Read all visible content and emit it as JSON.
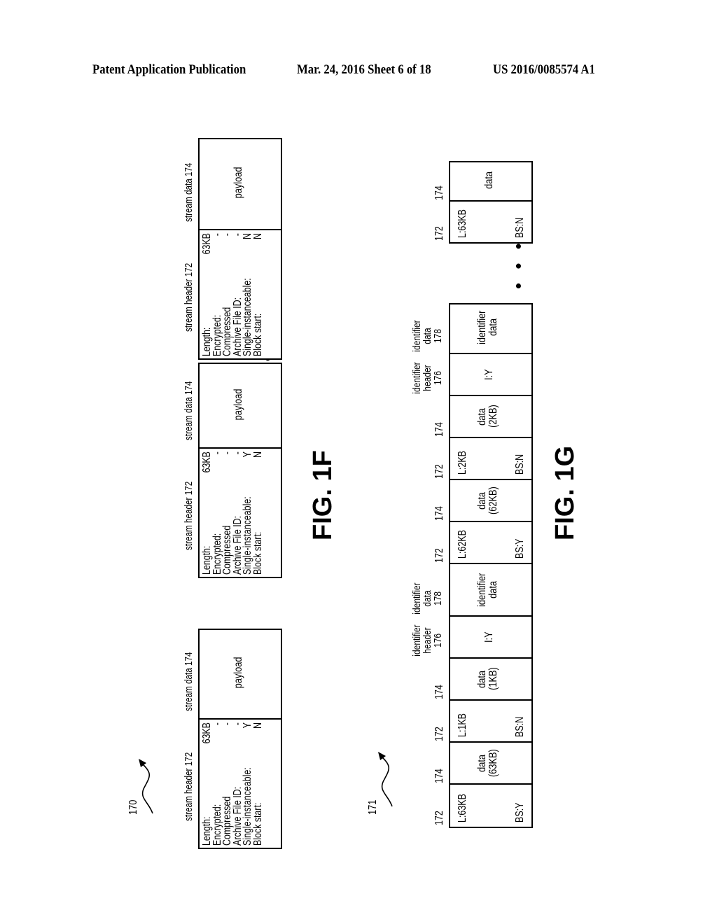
{
  "page_header": {
    "left": "Patent Application Publication",
    "center": "Mar. 24, 2016  Sheet 6 of 18",
    "right": "US 2016/0085574 A1"
  },
  "fig_1f": {
    "ref_number": "170",
    "caption": "FIG. 1F",
    "ellipsis": "• • •",
    "field_names": [
      "Length:",
      "Encrypted:",
      "Compressed",
      "Archive File ID:",
      "Single-instanceable:",
      "Block start:"
    ],
    "header_label": "stream header 172",
    "data_label": "stream data 174",
    "payload_text": "payload",
    "groups": [
      {
        "values": [
          "63KB",
          "-",
          "-",
          "-",
          "Y",
          "N"
        ]
      },
      {
        "values": [
          "63KB",
          "-",
          "-",
          "-",
          "Y",
          "N"
        ]
      },
      {
        "values": [
          "63KB",
          "-",
          "-",
          "-",
          "N",
          "N"
        ]
      }
    ]
  },
  "fig_1g": {
    "ref_number": "171",
    "caption": "FIG. 1G",
    "ellipsis": "• • •",
    "cells": [
      {
        "ref": "172",
        "type": "header",
        "length": "L:63KB",
        "bs": "BS:Y"
      },
      {
        "ref": "174",
        "type": "data",
        "line1": "data",
        "line2": "(63KB)"
      },
      {
        "ref": "172",
        "type": "header",
        "length": "L:1KB",
        "bs": "BS:N"
      },
      {
        "ref": "174",
        "type": "data",
        "line1": "data",
        "line2": "(1KB)"
      },
      {
        "ref_lines": [
          "identifier",
          "header",
          "176"
        ],
        "type": "idheader",
        "text": "I:Y"
      },
      {
        "ref_lines": [
          "identifier",
          "data",
          "178"
        ],
        "type": "iddata",
        "line1": "identifier",
        "line2": "data"
      },
      {
        "ref": "172",
        "type": "header",
        "length": "L:62KB",
        "bs": "BS:Y"
      },
      {
        "ref": "174",
        "type": "data",
        "line1": "data",
        "line2": "(62KB)"
      },
      {
        "ref": "172",
        "type": "header",
        "length": "L:2KB",
        "bs": "BS:N"
      },
      {
        "ref": "174",
        "type": "data",
        "line1": "data",
        "line2": "(2KB)"
      },
      {
        "ref_lines": [
          "identifier",
          "header",
          "176"
        ],
        "type": "idheader",
        "text": "I:Y"
      },
      {
        "ref_lines": [
          "identifier",
          "data",
          "178"
        ],
        "type": "iddata",
        "line1": "identifier",
        "line2": "data"
      }
    ],
    "tail_cells": [
      {
        "ref": "172",
        "type": "header",
        "length": "L:63KB",
        "bs": "BS:N"
      },
      {
        "ref": "174",
        "type": "data",
        "line1": "data"
      }
    ]
  }
}
